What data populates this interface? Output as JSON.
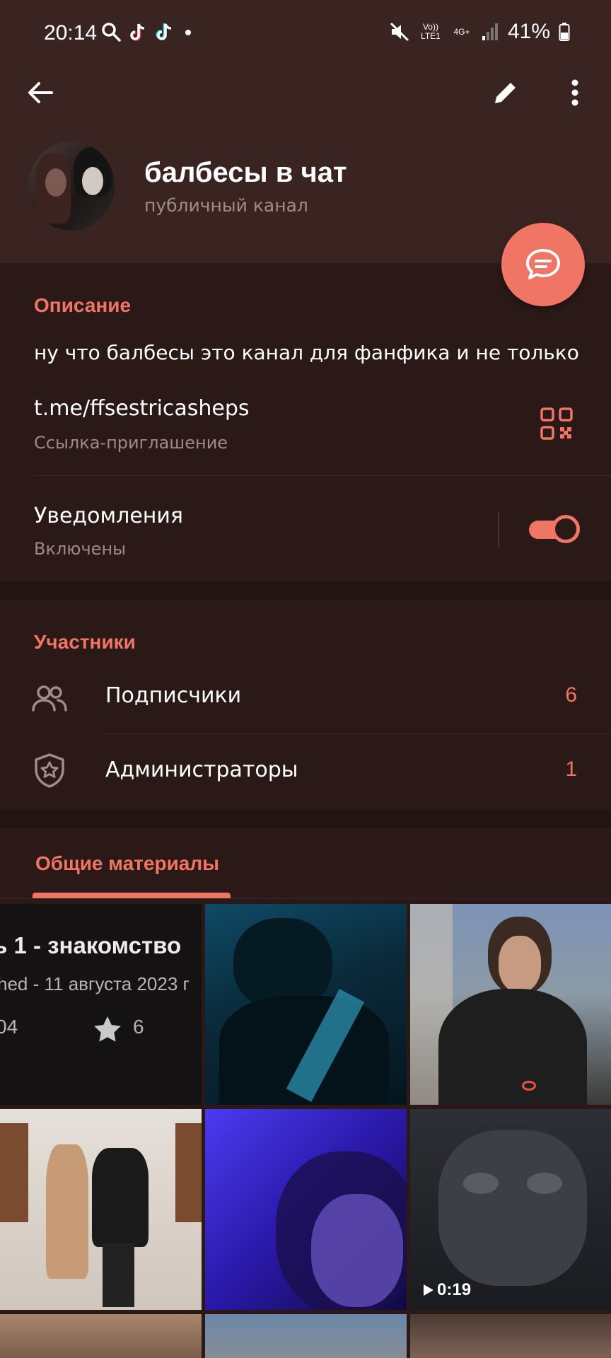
{
  "status_bar": {
    "time": "20:14",
    "volte_label": "Vo)) LTE1",
    "network_label": "4G+",
    "battery": "41%"
  },
  "toolbar": {
    "back_icon": "arrow-left-icon",
    "edit_icon": "pencil-icon",
    "more_icon": "more-vertical-icon"
  },
  "channel": {
    "title": "балбесы в чат",
    "subtitle": "публичный канал"
  },
  "info": {
    "description_header": "Описание",
    "description": "ну что балбесы это канал для фанфика и не только",
    "link": "t.me/ffsestricasheps",
    "link_caption": "Ссылка-приглашение",
    "notifications_label": "Уведомления",
    "notifications_state": "Включены",
    "notifications_on": true
  },
  "members": {
    "header": "Участники",
    "rows": [
      {
        "label": "Подписчики",
        "count": "6",
        "icon": "people-icon"
      },
      {
        "label": "Администраторы",
        "count": "1",
        "icon": "shield-star-icon"
      }
    ]
  },
  "media": {
    "tab_label": "Общие материалы",
    "card_text": {
      "title_fragment": "ь 1 - знакомство",
      "date_fragment": "hed - 11 августа 2023 г",
      "views_fragment": "04",
      "stars": "6"
    },
    "video_duration": "0:19"
  },
  "colors": {
    "accent": "#f07564",
    "background": "#2b1917",
    "header_background": "#3a2422"
  }
}
